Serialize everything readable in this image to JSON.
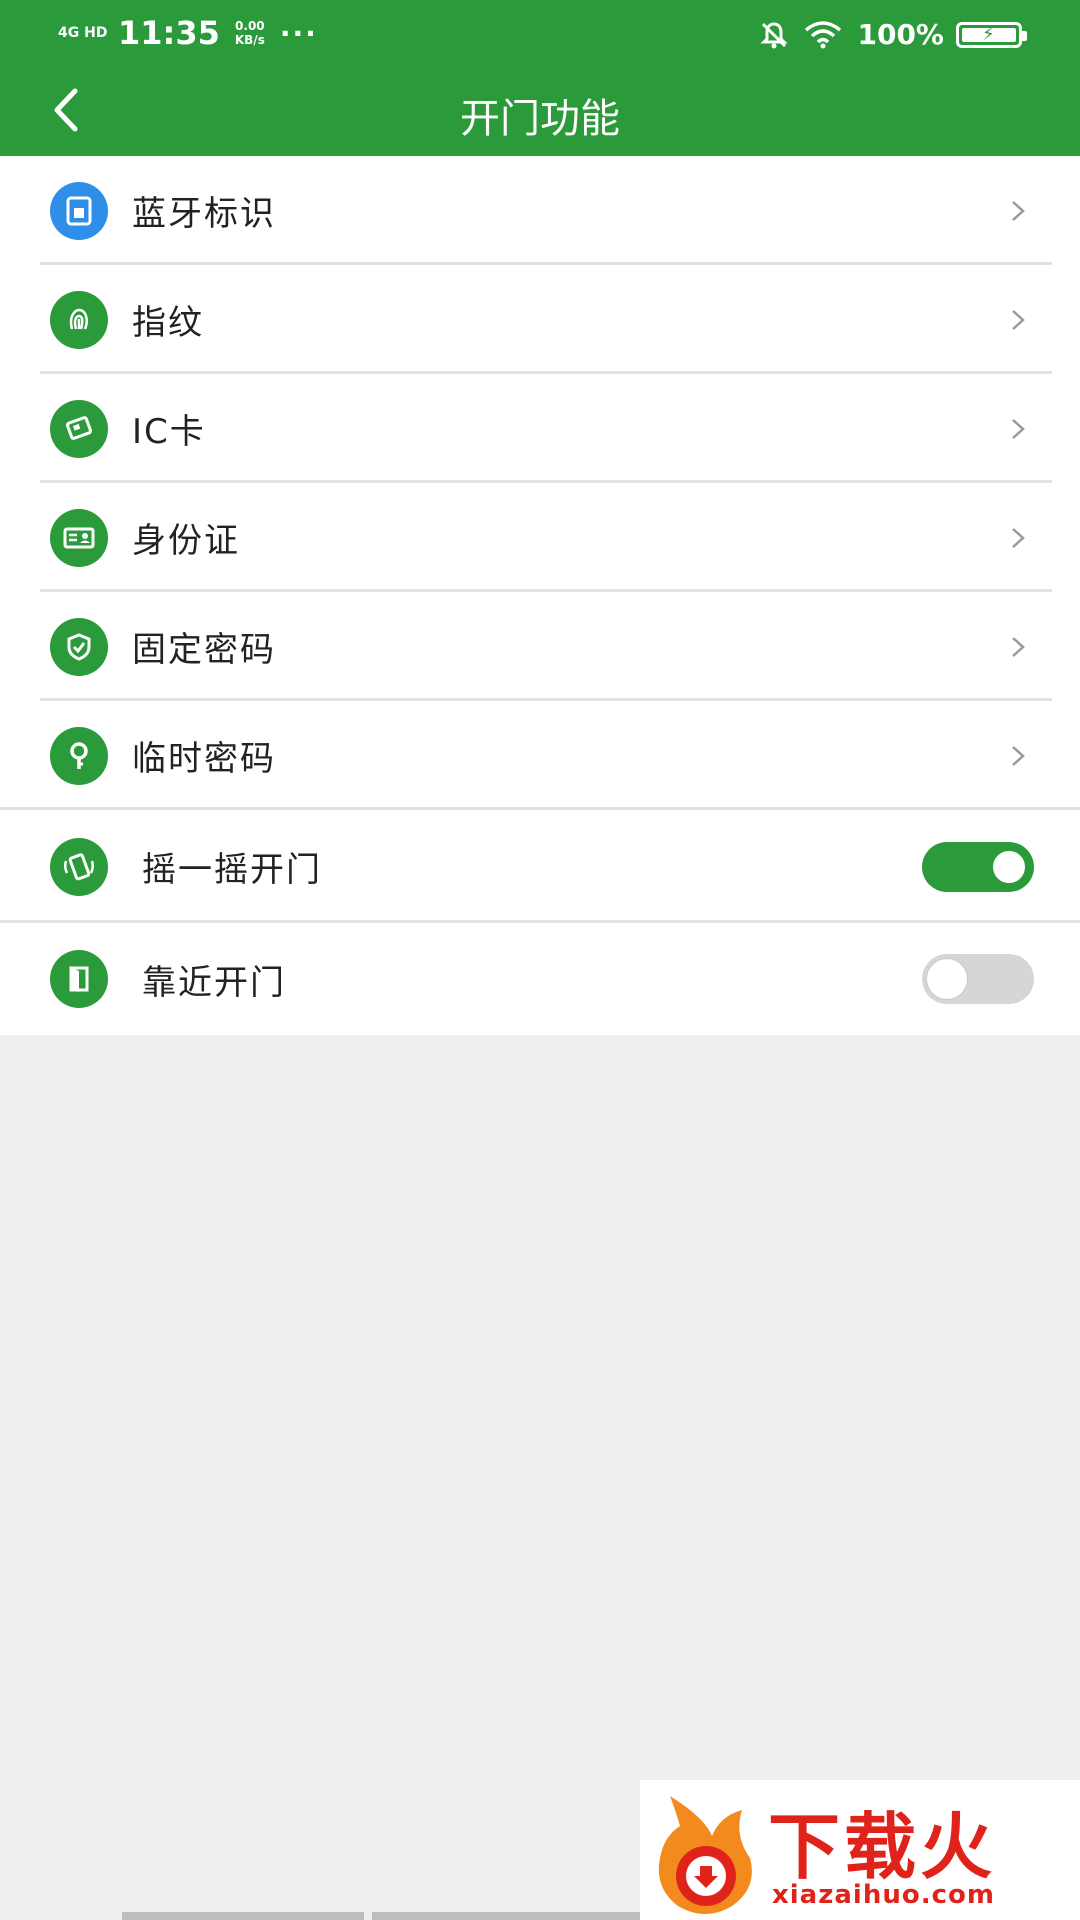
{
  "status_bar": {
    "network": "4G HD",
    "time": "11:35",
    "speed": "0.00 KB/s",
    "dots": "···",
    "battery": "100%"
  },
  "header": {
    "title": "开门功能"
  },
  "menu": {
    "items": [
      {
        "label": "蓝牙标识",
        "icon": "bluetooth-tag-icon",
        "color": "#2f8fe8"
      },
      {
        "label": "指纹",
        "icon": "fingerprint-icon",
        "color": "#2a9a3a"
      },
      {
        "label": "IC卡",
        "icon": "ic-card-icon",
        "color": "#2a9a3a"
      },
      {
        "label": "身份证",
        "icon": "id-card-icon",
        "color": "#2a9a3a"
      },
      {
        "label": "固定密码",
        "icon": "shield-icon",
        "color": "#2a9a3a"
      },
      {
        "label": "临时密码",
        "icon": "key-icon",
        "color": "#2a9a3a"
      }
    ]
  },
  "toggles": [
    {
      "label": "摇一摇开门",
      "icon": "shake-phone-icon",
      "on": true
    },
    {
      "label": "靠近开门",
      "icon": "door-icon",
      "on": false
    }
  ],
  "watermark": {
    "name": "下载火",
    "url": "xiazaihuo.com"
  },
  "colors": {
    "primary": "#2a9a3a",
    "accent_blue": "#2f8fe8",
    "background": "#efefef"
  }
}
